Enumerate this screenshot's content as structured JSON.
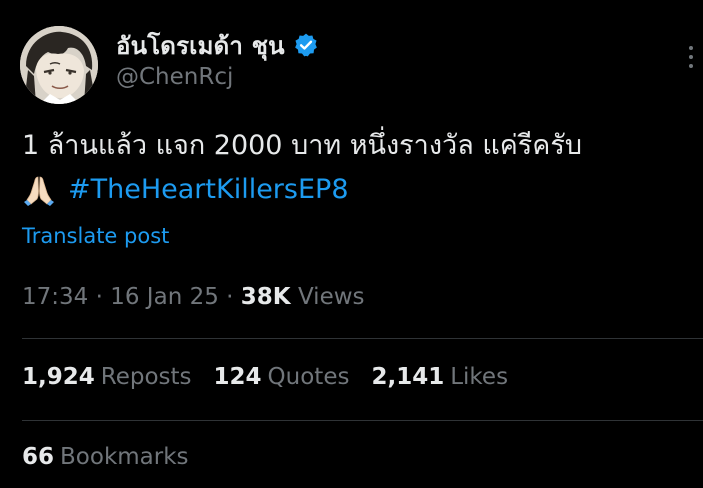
{
  "author": {
    "display_name": "อันโดรเมด้า ชุน",
    "handle": "@ChenRcj",
    "verified": true,
    "avatar": "avatar-illustration"
  },
  "post": {
    "text_line1": "1 ล้านแล้ว แจก 2000 บาท หนึ่งรางวัล แค่รีครับ",
    "emoji": "🙏🏻",
    "hashtag": "#TheHeartKillersEP8",
    "translate_label": "Translate post"
  },
  "meta": {
    "time": "17:34",
    "separator": "·",
    "date": "16 Jan 25",
    "views_count": "38K",
    "views_label": "Views"
  },
  "stats": {
    "reposts": {
      "count": "1,924",
      "label": "Reposts"
    },
    "quotes": {
      "count": "124",
      "label": "Quotes"
    },
    "likes": {
      "count": "2,141",
      "label": "Likes"
    },
    "bookmarks": {
      "count": "66",
      "label": "Bookmarks"
    }
  },
  "colors": {
    "background": "#000000",
    "text": "#e7e9ea",
    "secondary": "#71767b",
    "accent": "#1d9bf0",
    "divider": "#2f3336"
  },
  "icons": {
    "verified": "verified-badge-icon",
    "more": "more-options-icon"
  }
}
